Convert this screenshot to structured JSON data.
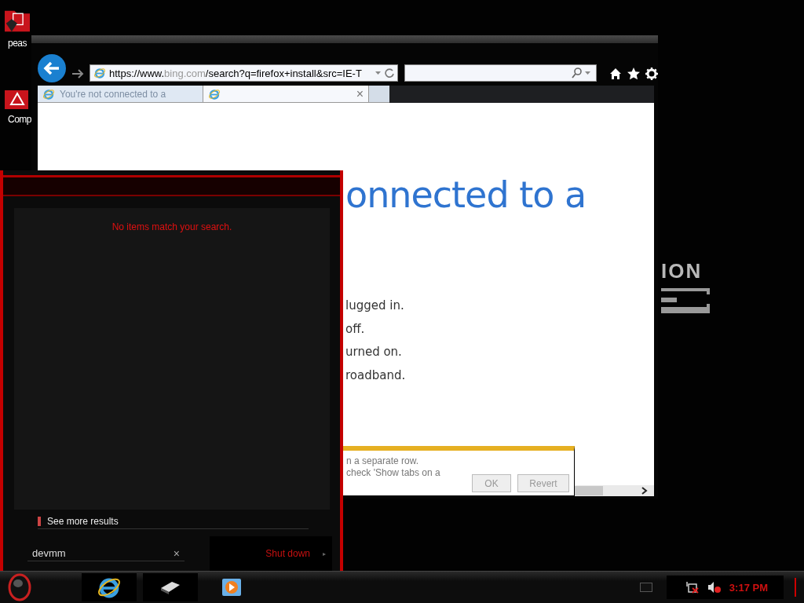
{
  "desktop_icons": [
    {
      "label": "peas",
      "kind": "folder"
    },
    {
      "label": "Comp",
      "kind": "warning"
    }
  ],
  "wallpaper": {
    "logo_text": "ION"
  },
  "browser": {
    "address": {
      "prefix": "https://www.",
      "domain": "bing.com",
      "path": "/search?q=firefox+install&src=IE-T"
    },
    "tabs": [
      {
        "title": "You're not connected to a",
        "selected": false
      },
      {
        "close": "×",
        "selected": true
      }
    ],
    "page": {
      "heading": "onnected to a",
      "lines": [
        "lugged in.",
        "off.",
        "urned on.",
        "roadband."
      ]
    },
    "notification": {
      "lines": [
        "n a separate row.",
        "check 'Show tabs on a"
      ],
      "buttons": [
        {
          "label": "OK",
          "disabled": true
        },
        {
          "label": "Revert",
          "disabled": true
        }
      ]
    }
  },
  "start_menu": {
    "message": "No items match your search.",
    "more_results": "See more results",
    "search": {
      "value": "devmm",
      "clear": "×"
    },
    "shutdown": {
      "label": "Shut down",
      "arrow": "▸"
    }
  },
  "taskbar": {
    "apps": [
      {
        "kind": "browser",
        "selected": true
      },
      {
        "kind": "device",
        "selected": true
      },
      {
        "kind": "media",
        "selected": false
      }
    ]
  },
  "tray": {
    "clock": "3:17 PM",
    "network_connected": false,
    "volume_muted": true
  }
}
